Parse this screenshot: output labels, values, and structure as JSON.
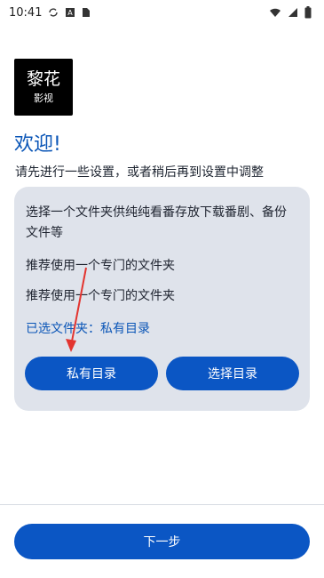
{
  "status_bar": {
    "time": "10:41",
    "icons": [
      "sync-icon",
      "app-a-icon",
      "file-icon",
      "wifi-icon",
      "signal-icon",
      "battery-icon"
    ]
  },
  "logo": {
    "text_top": "黎花",
    "text_bottom": "影视"
  },
  "welcome": {
    "title": "欢迎!",
    "subtitle": "请先进行一些设置，或者稍后再到设置中调整"
  },
  "card": {
    "description": "选择一个文件夹供纯纯看番存放下载番剧、备份文件等",
    "recommend_1": "推荐使用一个专门的文件夹",
    "recommend_2": "推荐使用一个专门的文件夹",
    "selected_label": "已选文件夹：私有目录",
    "buttons": {
      "private": "私有目录",
      "choose": "选择目录"
    }
  },
  "footer": {
    "next": "下一步"
  },
  "colors": {
    "accent": "#0b56c4",
    "title_blue": "#0b56b7",
    "card_bg": "#dfe3eb",
    "annotation_red": "#e3342f"
  }
}
